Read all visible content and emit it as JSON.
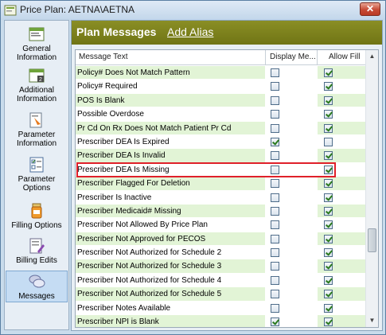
{
  "window": {
    "title": "Price Plan: AETNA\\AETNA",
    "close_icon": "close-icon"
  },
  "sidebar": {
    "items": [
      {
        "label": "General Information",
        "icon": "general-info-icon"
      },
      {
        "label": "Additional Information",
        "icon": "additional-info-icon"
      },
      {
        "label": "Parameter Information",
        "icon": "parameter-info-icon"
      },
      {
        "label": "Parameter Options",
        "icon": "parameter-options-icon"
      },
      {
        "label": "Filling Options",
        "icon": "filling-options-icon"
      },
      {
        "label": "Billing Edits",
        "icon": "billing-edits-icon"
      },
      {
        "label": "Messages",
        "icon": "messages-icon",
        "active": true
      }
    ]
  },
  "main": {
    "title": "Plan Messages",
    "add_alias": "Add Alias",
    "columns": [
      "Message Text",
      "Display Me...",
      "Allow Fill"
    ],
    "rows": [
      {
        "text": "Policy# Does Not Match Pattern",
        "display": false,
        "allow": true
      },
      {
        "text": "Policy# Required",
        "display": false,
        "allow": true
      },
      {
        "text": "POS Is Blank",
        "display": false,
        "allow": true
      },
      {
        "text": "Possible Overdose",
        "display": false,
        "allow": true
      },
      {
        "text": "Pr Cd On Rx Does Not Match Patient Pr Cd",
        "display": false,
        "allow": true
      },
      {
        "text": "Prescriber DEA Is Expired",
        "display": true,
        "allow": false
      },
      {
        "text": "Prescriber DEA Is Invalid",
        "display": false,
        "allow": true
      },
      {
        "text": "Prescriber DEA Is Missing",
        "display": false,
        "allow": true
      },
      {
        "text": "Prescriber Flagged For Deletion",
        "display": false,
        "allow": true
      },
      {
        "text": "Prescriber Is Inactive",
        "display": false,
        "allow": true
      },
      {
        "text": "Prescriber Medicaid# Missing",
        "display": false,
        "allow": true
      },
      {
        "text": "Prescriber Not Allowed By Price Plan",
        "display": false,
        "allow": true
      },
      {
        "text": "Prescriber Not Approved for PECOS",
        "display": false,
        "allow": true
      },
      {
        "text": "Prescriber Not Authorized for Schedule 2",
        "display": false,
        "allow": true
      },
      {
        "text": "Prescriber Not Authorized for Schedule 3",
        "display": false,
        "allow": true
      },
      {
        "text": "Prescriber Not Authorized for Schedule 4",
        "display": false,
        "allow": true
      },
      {
        "text": "Prescriber Not Authorized for Schedule 5",
        "display": false,
        "allow": true
      },
      {
        "text": "Prescriber Notes Available",
        "display": false,
        "allow": true
      },
      {
        "text": "Prescriber NPI is Blank",
        "display": true,
        "allow": true
      }
    ]
  },
  "colors": {
    "header_bg": "#7a7e1c",
    "row_green": "#e2f4d6",
    "highlight_red": "#e0202a",
    "check_green": "#2a7a1e"
  }
}
